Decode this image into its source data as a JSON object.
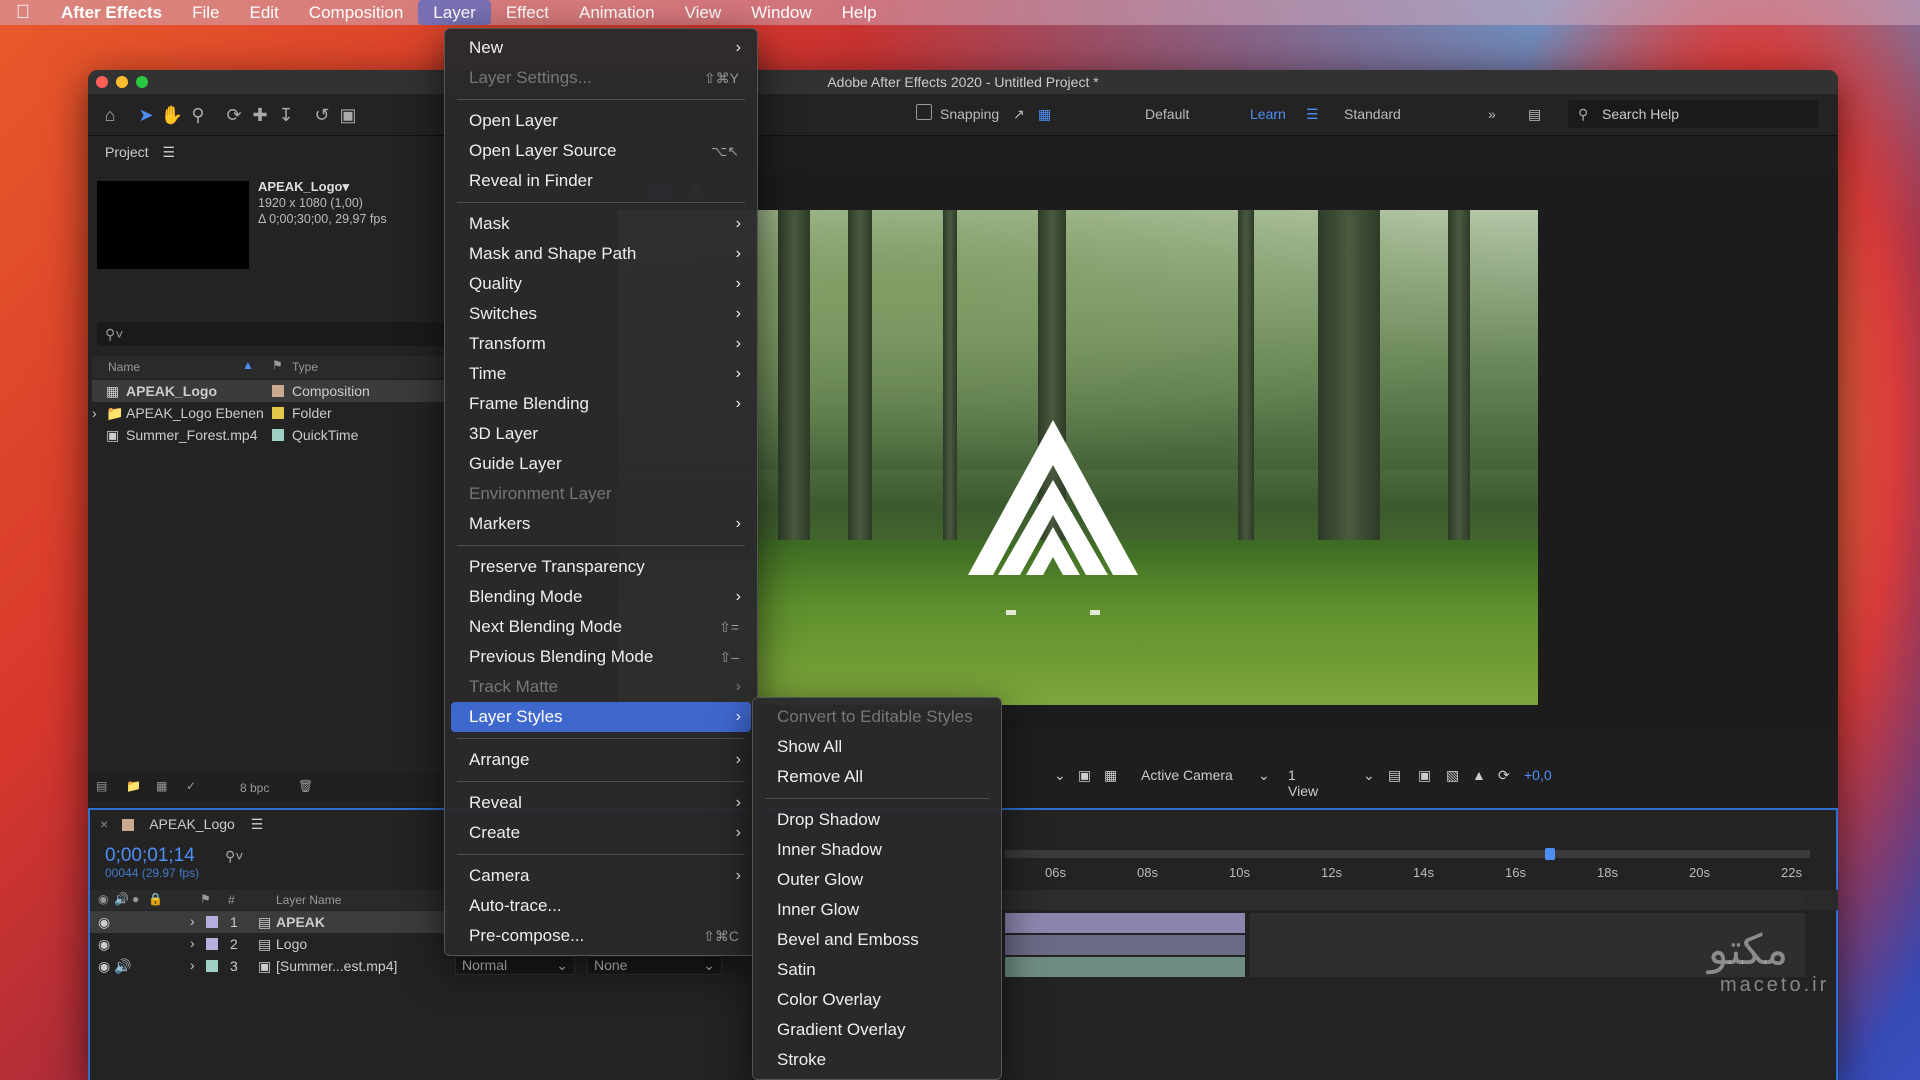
{
  "menubar": {
    "app": "After Effects",
    "items": [
      "File",
      "Edit",
      "Composition",
      "Layer",
      "Effect",
      "Animation",
      "View",
      "Window",
      "Help"
    ],
    "active": "Layer"
  },
  "window": {
    "title": "Adobe After Effects 2020 - Untitled Project *"
  },
  "toolbar": {
    "snapping": "Snapping",
    "workspaces": [
      "Default",
      "Learn",
      "Standard"
    ],
    "search_placeholder": "Search Help"
  },
  "project": {
    "panel_title": "Project",
    "selected": {
      "name": "APEAK_Logo▾",
      "resolution": "1920 x 1080 (1,00)",
      "duration": "Δ 0;00;30;00, 29,97 fps"
    },
    "columns": {
      "name": "Name",
      "type": "Type"
    },
    "items": [
      {
        "name": "APEAK_Logo",
        "type": "Composition",
        "color": "#c9a98f"
      },
      {
        "name": "APEAK_Logo Ebenen",
        "type": "Folder",
        "color": "#e2c94a"
      },
      {
        "name": "Summer_Forest.mp4",
        "type": "QuickTime",
        "color": "#9fd0c6"
      }
    ],
    "bpc": "8 bpc"
  },
  "viewer": {
    "tab_fragment": "ogo",
    "camera": "Active Camera",
    "views": "1 View",
    "exposure": "+0,0"
  },
  "timeline": {
    "comp_name": "APEAK_Logo",
    "timecode": "0;00;01;14",
    "frame_info": "00044 (29.97 fps)",
    "layer_name_header": "Layer Name",
    "hash_header": "#",
    "layers": [
      {
        "num": "1",
        "name": "APEAK",
        "color": "#b7aee0"
      },
      {
        "num": "2",
        "name": "Logo",
        "color": "#b7aee0"
      },
      {
        "num": "3",
        "name": "[Summer...est.mp4]",
        "color": "#9fd0c6"
      }
    ],
    "mode": "Normal",
    "track_matte": "None",
    "ruler": [
      "06s",
      "08s",
      "10s",
      "12s",
      "14s",
      "16s",
      "18s",
      "20s",
      "22s"
    ]
  },
  "layer_menu": {
    "items": [
      {
        "label": "New",
        "arrow": true
      },
      {
        "label": "Layer Settings...",
        "shortcut": "⇧⌘Y",
        "disabled": true
      },
      {
        "sep": true
      },
      {
        "label": "Open Layer"
      },
      {
        "label": "Open Layer Source",
        "shortcut": "⌥↖"
      },
      {
        "label": "Reveal in Finder"
      },
      {
        "sep": true
      },
      {
        "label": "Mask",
        "arrow": true
      },
      {
        "label": "Mask and Shape Path",
        "arrow": true
      },
      {
        "label": "Quality",
        "arrow": true
      },
      {
        "label": "Switches",
        "arrow": true
      },
      {
        "label": "Transform",
        "arrow": true
      },
      {
        "label": "Time",
        "arrow": true
      },
      {
        "label": "Frame Blending",
        "arrow": true
      },
      {
        "label": "3D Layer"
      },
      {
        "label": "Guide Layer"
      },
      {
        "label": "Environment Layer",
        "disabled": true
      },
      {
        "label": "Markers",
        "arrow": true
      },
      {
        "sep": true
      },
      {
        "label": "Preserve Transparency"
      },
      {
        "label": "Blending Mode",
        "arrow": true
      },
      {
        "label": "Next Blending Mode",
        "shortcut": "⇧="
      },
      {
        "label": "Previous Blending Mode",
        "shortcut": "⇧–"
      },
      {
        "label": "Track Matte",
        "arrow": true,
        "disabled": true
      },
      {
        "label": "Layer Styles",
        "arrow": true,
        "highlighted": true
      },
      {
        "sep": true
      },
      {
        "label": "Arrange",
        "arrow": true
      },
      {
        "sep": true
      },
      {
        "label": "Reveal",
        "arrow": true
      },
      {
        "label": "Create",
        "arrow": true
      },
      {
        "sep": true
      },
      {
        "label": "Camera",
        "arrow": true
      },
      {
        "label": "Auto-trace..."
      },
      {
        "label": "Pre-compose...",
        "shortcut": "⇧⌘C"
      }
    ]
  },
  "layer_styles_menu": {
    "items": [
      {
        "label": "Convert to Editable Styles",
        "disabled": true
      },
      {
        "label": "Show All"
      },
      {
        "label": "Remove All"
      },
      {
        "sep": true
      },
      {
        "label": "Drop Shadow"
      },
      {
        "label": "Inner Shadow"
      },
      {
        "label": "Outer Glow"
      },
      {
        "label": "Inner Glow"
      },
      {
        "label": "Bevel and Emboss"
      },
      {
        "label": "Satin"
      },
      {
        "label": "Color Overlay"
      },
      {
        "label": "Gradient Overlay"
      },
      {
        "label": "Stroke"
      }
    ]
  },
  "watermark": {
    "arabic": "مکتو",
    "latin": "maceto.ir"
  },
  "colors": {
    "accent": "#4d8ff5",
    "highlight": "#3f68cf"
  }
}
